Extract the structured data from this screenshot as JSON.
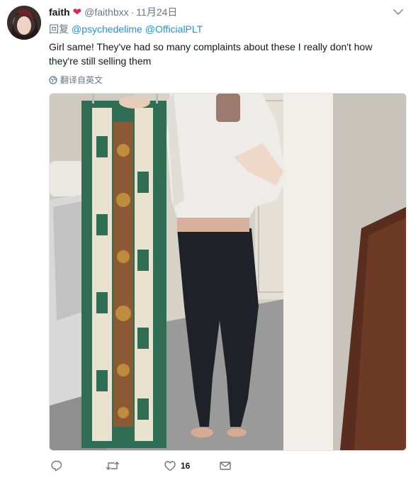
{
  "tweet": {
    "display_name": "faith",
    "handle": "@faithbxx",
    "separator": "·",
    "date": "11月24日",
    "reply_prefix": "回复",
    "reply_to": [
      "@psychedelime",
      "@OfficialPLT"
    ],
    "text": "Girl same! They've had so many complaints about these I really don't how they're still selling them",
    "translate_label": "翻译自英文"
  },
  "actions": {
    "reply_count": "",
    "retweet_count": "",
    "like_count": "16"
  },
  "colors": {
    "link": "#1b95e0",
    "muted": "#657786",
    "heart": "#e0245e"
  },
  "icons": [
    "verified-heart-icon",
    "caret-down-icon",
    "globe-icon",
    "reply-icon",
    "retweet-icon",
    "like-icon",
    "message-icon"
  ]
}
